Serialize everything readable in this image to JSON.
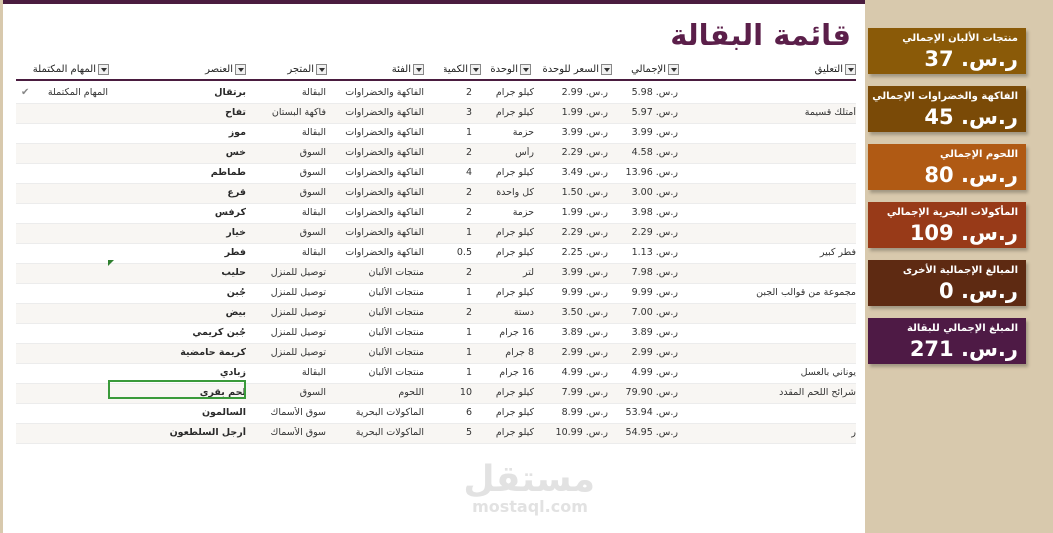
{
  "title": "قائمة البقالة",
  "headers": {
    "done": "المهام المكتملة",
    "item": "العنصر",
    "store": "المتجر",
    "category": "الفئة",
    "qty": "الكمية",
    "unit": "الوحدة",
    "unit_price": "السعر للوحدة",
    "total": "الإجمالي",
    "note": "التعليق"
  },
  "rows": [
    {
      "done": "المهام المكتملة",
      "check": "✔",
      "item": "برتقال",
      "store": "البقالة",
      "category": "الفاكهة والخضراوات",
      "qty": "2",
      "unit": "كيلو جرام",
      "unit_price": "ر.س. 2.99",
      "total": "ر.س. 5.98",
      "note": ""
    },
    {
      "done": "",
      "check": "",
      "item": "تفاح",
      "store": "فاكهة البستان",
      "category": "الفاكهة والخضراوات",
      "qty": "3",
      "unit": "كيلو جرام",
      "unit_price": "ر.س. 1.99",
      "total": "ر.س. 5.97",
      "note": "أمتلك قسيمة"
    },
    {
      "done": "",
      "check": "",
      "item": "موز",
      "store": "البقالة",
      "category": "الفاكهة والخضراوات",
      "qty": "1",
      "unit": "حزمة",
      "unit_price": "ر.س. 3.99",
      "total": "ر.س. 3.99",
      "note": ""
    },
    {
      "done": "",
      "check": "",
      "item": "خس",
      "store": "السوق",
      "category": "الفاكهة والخضراوات",
      "qty": "2",
      "unit": "رأس",
      "unit_price": "ر.س. 2.29",
      "total": "ر.س. 4.58",
      "note": ""
    },
    {
      "done": "",
      "check": "",
      "item": "طماطم",
      "store": "السوق",
      "category": "الفاكهة والخضراوات",
      "qty": "4",
      "unit": "كيلو جرام",
      "unit_price": "ر.س. 3.49",
      "total": "ر.س. 13.96",
      "note": ""
    },
    {
      "done": "",
      "check": "",
      "item": "قرع",
      "store": "السوق",
      "category": "الفاكهة والخضراوات",
      "qty": "2",
      "unit": "كل واحدة",
      "unit_price": "ر.س. 1.50",
      "total": "ر.س. 3.00",
      "note": ""
    },
    {
      "done": "",
      "check": "",
      "item": "كرفس",
      "store": "البقالة",
      "category": "الفاكهة والخضراوات",
      "qty": "2",
      "unit": "حزمة",
      "unit_price": "ر.س. 1.99",
      "total": "ر.س. 3.98",
      "note": ""
    },
    {
      "done": "",
      "check": "",
      "item": "خيار",
      "store": "السوق",
      "category": "الفاكهة والخضراوات",
      "qty": "1",
      "unit": "كيلو جرام",
      "unit_price": "ر.س. 2.29",
      "total": "ر.س. 2.29",
      "note": ""
    },
    {
      "done": "",
      "check": "",
      "item": "فطر",
      "store": "البقالة",
      "category": "الفاكهة والخضراوات",
      "qty": "0.5",
      "unit": "كيلو جرام",
      "unit_price": "ر.س. 2.25",
      "total": "ر.س. 1.13",
      "note": "فطر كبير"
    },
    {
      "done": "",
      "check": "",
      "item": "حليب",
      "store": "توصيل للمنزل",
      "category": "منتجات الألبان",
      "qty": "2",
      "unit": "لتر",
      "unit_price": "ر.س. 3.99",
      "total": "ر.س. 7.98",
      "note": ""
    },
    {
      "done": "",
      "check": "",
      "item": "جُبن",
      "store": "توصيل للمنزل",
      "category": "منتجات الألبان",
      "qty": "1",
      "unit": "كيلو جرام",
      "unit_price": "ر.س. 9.99",
      "total": "ر.س. 9.99",
      "note": "مجموعة من قوالب الجبن"
    },
    {
      "done": "",
      "check": "",
      "item": "بيض",
      "store": "توصيل للمنزل",
      "category": "منتجات الألبان",
      "qty": "2",
      "unit": "دستة",
      "unit_price": "ر.س. 3.50",
      "total": "ر.س. 7.00",
      "note": ""
    },
    {
      "done": "",
      "check": "",
      "item": "جُبن كريمي",
      "store": "توصيل للمنزل",
      "category": "منتجات الألبان",
      "qty": "1",
      "unit": "16 جرام",
      "unit_price": "ر.س. 3.89",
      "total": "ر.س. 3.89",
      "note": ""
    },
    {
      "done": "",
      "check": "",
      "item": "كريمة حامضية",
      "store": "توصيل للمنزل",
      "category": "منتجات الألبان",
      "qty": "1",
      "unit": "8 جرام",
      "unit_price": "ر.س. 2.99",
      "total": "ر.س. 2.99",
      "note": ""
    },
    {
      "done": "",
      "check": "",
      "item": "زبادي",
      "store": "البقالة",
      "category": "منتجات الألبان",
      "qty": "1",
      "unit": "16 جرام",
      "unit_price": "ر.س. 4.99",
      "total": "ر.س. 4.99",
      "note": "يوناني بالعسل"
    },
    {
      "done": "",
      "check": "",
      "item": "لحم بقري",
      "store": "السوق",
      "category": "اللحوم",
      "qty": "10",
      "unit": "كيلو جرام",
      "unit_price": "ر.س. 7.99",
      "total": "ر.س. 79.90",
      "note": "شرائح اللحم المقدد"
    },
    {
      "done": "",
      "check": "",
      "item": "السالمون",
      "store": "سوق الأسماك",
      "category": "المأكولات البحرية",
      "qty": "6",
      "unit": "كيلو جرام",
      "unit_price": "ر.س. 8.99",
      "total": "ر.س. 53.94",
      "note": ""
    },
    {
      "done": "",
      "check": "",
      "item": "أرجل السلطعون",
      "store": "سوق الأسماك",
      "category": "المأكولات البحرية",
      "qty": "5",
      "unit": "كيلو جرام",
      "unit_price": "ر.س. 10.99",
      "total": "ر.س. 54.95",
      "note": "ر"
    }
  ],
  "cards": [
    {
      "label": "منتجات الألبان الإجمالي",
      "value": "ر.س. 37",
      "color": "#8a5a08"
    },
    {
      "label": "الفاكهة والخضراوات الإجمالي",
      "value": "ر.س. 45",
      "color": "#7a4a07"
    },
    {
      "label": "اللحوم الإجمالي",
      "value": "ر.س. 80",
      "color": "#b05a14"
    },
    {
      "label": "المأكولات البحرية الإجمالي",
      "value": "ر.س. 109",
      "color": "#983a18"
    },
    {
      "label": "المبالغ الإجمالية الأخرى",
      "value": "ر.س. 0",
      "color": "#5e2a12"
    },
    {
      "label": "المبلغ الإجمالي للبقالة",
      "value": "ر.س. 271",
      "color": "#4e1a45"
    }
  ],
  "watermark": {
    "arabic": "مستقل",
    "latin": "mostaql.com"
  }
}
